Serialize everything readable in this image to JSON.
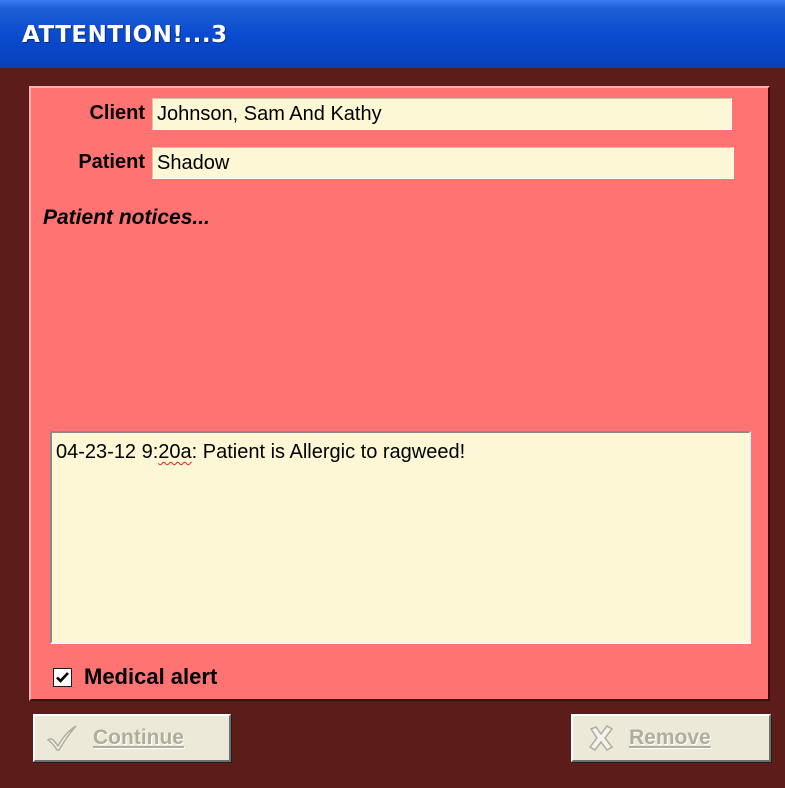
{
  "window": {
    "title": "ATTENTION!...3"
  },
  "client": {
    "label": "Client",
    "value": "Johnson, Sam And Kathy"
  },
  "patient": {
    "label": "Patient",
    "value": "Shadow"
  },
  "notices": {
    "heading": "Patient notices..."
  },
  "memo": {
    "prefix": "04-23-12 9:",
    "squiggly": "20a",
    "suffix": ": Patient is Allergic to ragweed!"
  },
  "medical_alert": {
    "label": "Medical alert",
    "checked": true
  },
  "buttons": {
    "continue_label": "Continue",
    "remove_label": "Remove",
    "continue_icon": "checkmark-icon",
    "remove_icon": "x-icon"
  },
  "colors": {
    "titlebar": "#0a4bd0",
    "frame": "#5c1c1a",
    "panel": "#ff7373",
    "field_bg": "#fdf7d6",
    "disabled_text": "#b0ad9f"
  }
}
